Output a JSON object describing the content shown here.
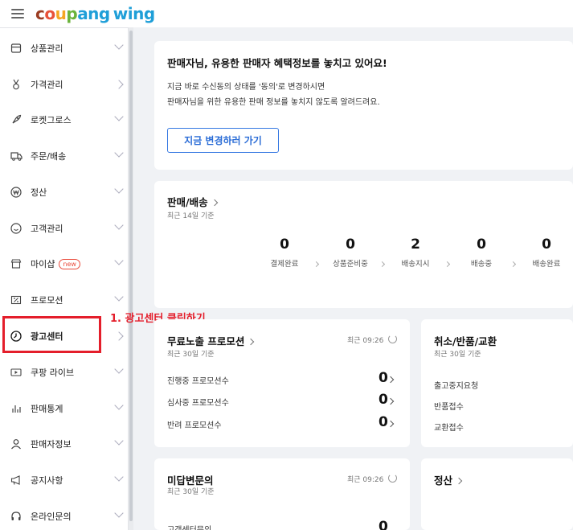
{
  "logo": {
    "c": "c",
    "o": "o",
    "u": "u",
    "p": "p",
    "ang": "ang",
    "wing": "wing"
  },
  "sidebar": {
    "items": [
      {
        "label": "상품관리",
        "icon": "box-icon"
      },
      {
        "label": "가격관리",
        "icon": "medal-icon"
      },
      {
        "label": "로켓그로스",
        "icon": "rocket-icon"
      },
      {
        "label": "주문/배송",
        "icon": "truck-icon"
      },
      {
        "label": "정산",
        "icon": "won-icon"
      },
      {
        "label": "고객관리",
        "icon": "smile-icon"
      },
      {
        "label": "마이샵",
        "icon": "store-icon",
        "badge": "new"
      },
      {
        "label": "프로모션",
        "icon": "coupon-icon"
      },
      {
        "label": "광고센터",
        "icon": "clock-icon"
      },
      {
        "label": "쿠팡 라이브",
        "icon": "live-icon"
      },
      {
        "label": "판매통계",
        "icon": "chart-icon"
      },
      {
        "label": "판매자정보",
        "icon": "person-icon"
      },
      {
        "label": "공지사항",
        "icon": "megaphone-icon"
      },
      {
        "label": "온라인문의",
        "icon": "headset-icon"
      }
    ]
  },
  "annotation": "1. 광고센터 클릭하기",
  "consent_card": {
    "title": "판매자님, 유용한 판매자 혜택정보를 놓치고 있어요!",
    "line1": "지금 바로 수신동의 상태를 '동의'로 변경하시면",
    "line2": "판매자님을 위한 유용한 판매 정보를 놓치지 않도록 알려드려요.",
    "button": "지금 변경하러 가기"
  },
  "sales_card": {
    "title": "판매/배송",
    "subtitle": "최근 14일 기준",
    "stats": [
      {
        "value": "0",
        "label": "결제완료"
      },
      {
        "value": "0",
        "label": "상품준비중"
      },
      {
        "value": "2",
        "label": "배송지시"
      },
      {
        "value": "0",
        "label": "배송중"
      },
      {
        "value": "0",
        "label": "배송완료"
      }
    ]
  },
  "promo_card": {
    "title": "무료노출 프로모션",
    "subtitle": "최근 30일 기준",
    "recent": "최근 09:26",
    "rows": [
      {
        "label": "진행중 프로모션수",
        "value": "0"
      },
      {
        "label": "심사중 프로모션수",
        "value": "0"
      },
      {
        "label": "반려 프로모션수",
        "value": "0"
      }
    ]
  },
  "return_card": {
    "title": "취소/반품/교환",
    "subtitle": "최근 30일 기준",
    "rows": [
      "출고중지요청",
      "반품접수",
      "교환접수"
    ]
  },
  "unanswered_card": {
    "title": "미답변문의",
    "subtitle": "최근 30일 기준",
    "recent": "최근 09:26",
    "rows": [
      {
        "label": "고객센터문의",
        "value": "0"
      }
    ]
  },
  "settlement_card": {
    "title": "정산"
  }
}
